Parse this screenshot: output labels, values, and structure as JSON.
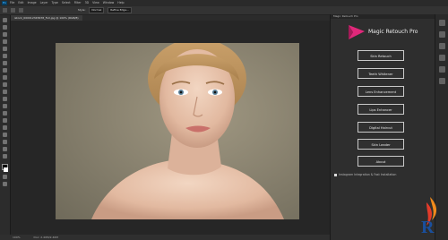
{
  "menubar": {
    "items": [
      "File",
      "Edit",
      "Image",
      "Layer",
      "Type",
      "Select",
      "Filter",
      "3D",
      "View",
      "Window",
      "Help"
    ]
  },
  "options": {
    "style_label": "Style:",
    "style_value": "Normal",
    "refine_label": "Refine Edge..."
  },
  "document": {
    "tab_label": "istock_000012345678_Full.jpg @ 100% (RGB/8)"
  },
  "status": {
    "zoom": "100%",
    "doc_info": "Doc: 2.40M/2.40M"
  },
  "panel": {
    "header": "Magic Retouch Pro",
    "title": "Magic Retouch Pro",
    "buttons": [
      "Skin Retouch",
      "Teeth Whitener",
      "Lens Enhancement",
      "Lips Enhancer",
      "Digital Haircut",
      "Skin Leader",
      "About"
    ],
    "checkbox_label": "Instagram Integration & Fast Installation"
  },
  "colors": {
    "accent": "#e0287a",
    "logo_blue": "#1a4f9c",
    "logo_orange": "#f08a1c"
  }
}
